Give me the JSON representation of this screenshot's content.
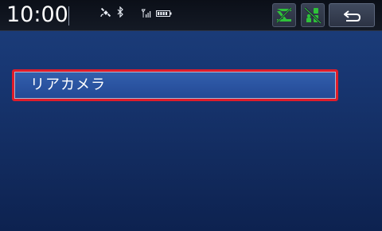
{
  "status_bar": {
    "time": "10:00",
    "icons": [
      "satellite-icon",
      "bluetooth-icon",
      "antenna-signal-icon",
      "battery-icon"
    ],
    "vics_icon": "vics-traffic-icon",
    "driver_icon": "driver-assist-icon",
    "back_icon": "back-arrow-icon"
  },
  "menu": {
    "items": [
      {
        "label": "リアカメラ",
        "selected": true
      }
    ]
  },
  "colors": {
    "background": "#183773",
    "item_fill": "#2a53a0",
    "selection_border": "#e01c2a",
    "status_icon_green": "#2fc23a",
    "status_bar": "#0b0f18"
  }
}
